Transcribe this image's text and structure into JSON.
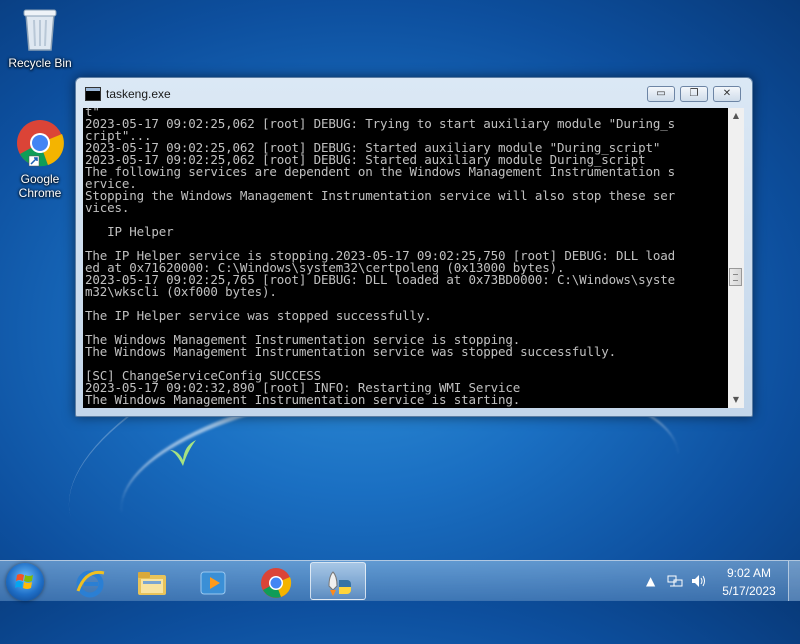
{
  "desktop": {
    "icons": [
      {
        "label": "Recycle Bin"
      },
      {
        "label": "Google Chrome"
      }
    ]
  },
  "window": {
    "title": "taskeng.exe",
    "console_lines": [
      "t\"",
      "2023-05-17 09:02:25,062 [root] DEBUG: Trying to start auxiliary module \"During_s",
      "cript\"...",
      "2023-05-17 09:02:25,062 [root] DEBUG: Started auxiliary module \"During_script\"",
      "2023-05-17 09:02:25,062 [root] DEBUG: Started auxiliary module During_script",
      "The following services are dependent on the Windows Management Instrumentation s",
      "ervice.",
      "Stopping the Windows Management Instrumentation service will also stop these ser",
      "vices.",
      "",
      "   IP Helper",
      "",
      "The IP Helper service is stopping.2023-05-17 09:02:25,750 [root] DEBUG: DLL load",
      "ed at 0x71620000: C:\\Windows\\system32\\certpoleng (0x13000 bytes).",
      "2023-05-17 09:02:25,765 [root] DEBUG: DLL loaded at 0x73BD0000: C:\\Windows\\syste",
      "m32\\wkscli (0xf000 bytes).",
      "",
      "The IP Helper service was stopped successfully.",
      "",
      "The Windows Management Instrumentation service is stopping.",
      "The Windows Management Instrumentation service was stopped successfully.",
      "",
      "[SC] ChangeServiceConfig SUCCESS",
      "2023-05-17 09:02:32,890 [root] INFO: Restarting WMI Service",
      "The Windows Management Instrumentation service is starting."
    ],
    "buttons": {
      "minimize": "▭",
      "maximize": "❐",
      "close": "✕"
    }
  },
  "taskbar": {
    "items": [
      "start",
      "internet-explorer",
      "file-explorer",
      "media-player",
      "chrome",
      "taskeng"
    ],
    "active_item": "taskeng"
  },
  "tray": {
    "time": "9:02 AM",
    "date": "5/17/2023"
  }
}
